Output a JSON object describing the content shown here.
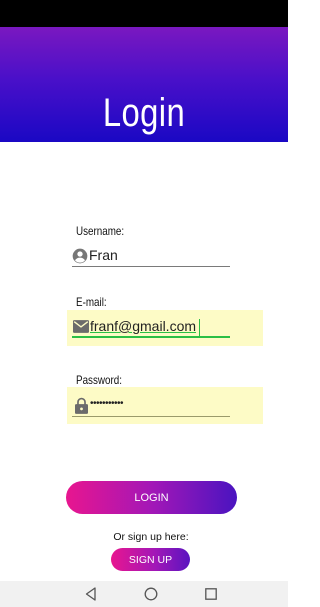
{
  "header": {
    "title": "Login"
  },
  "form": {
    "username": {
      "label": "Username:",
      "value": "Fran",
      "icon": "account-circle-icon"
    },
    "email": {
      "label": "E-mail:",
      "value": "franf@gmail.com",
      "icon": "mail-icon"
    },
    "password": {
      "label": "Password:",
      "value": "•••••••••••",
      "icon": "lock-icon"
    }
  },
  "actions": {
    "login_label": "LOGIN",
    "signup_hint": "Or sign up here:",
    "signup_label": "SIGN UP"
  },
  "nav": {
    "back": "back-icon",
    "home": "home-icon",
    "recents": "recents-icon"
  },
  "colors": {
    "header_top": "#7a18c0",
    "header_bottom": "#1a08c4",
    "button_start": "#e8168f",
    "button_end": "#4a14c0",
    "autofill_bg": "#fdfbc6"
  }
}
